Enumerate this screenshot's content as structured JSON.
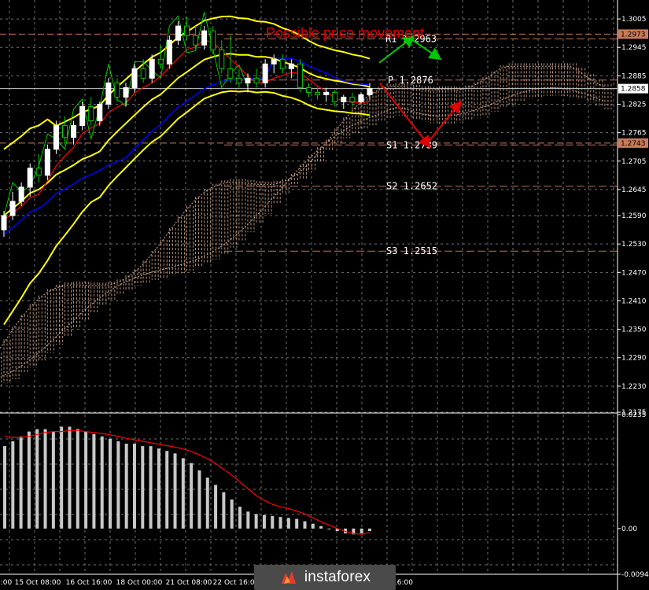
{
  "chart_data": {
    "type": "candlestick",
    "title": "Possible price movement",
    "price_axis": {
      "ticks": [
        "1.3005",
        "1.2945",
        "1.2885",
        "1.2825",
        "1.2765",
        "1.2705",
        "1.2645",
        "1.2590",
        "1.2530",
        "1.2470",
        "1.2410",
        "1.2350",
        "1.2290",
        "1.2230",
        "1.2175"
      ],
      "current_price": "1.2858",
      "marked_prices": [
        "1.2973",
        "1.2743"
      ],
      "range": [
        1.2175,
        1.3045
      ]
    },
    "indicator_axis": {
      "ticks": [
        "0.0235",
        "0.00",
        "-0.00942"
      ],
      "range": [
        -0.00942,
        0.0235
      ]
    },
    "time_axis": {
      "ticks": [
        ":00",
        "15 Oct 08:00",
        "16 Oct 16:00",
        "18 Oct 00:00",
        "21 Oct 08:00",
        "22 Oct 16:00",
        "16:00"
      ]
    },
    "levels": [
      {
        "name": "R1",
        "label": "R1 1.2963",
        "value": 1.2963
      },
      {
        "name": "P",
        "label": "P 1.2876",
        "value": 1.2876
      },
      {
        "name": "S1",
        "label": "S1 1.2739",
        "value": 1.2739
      },
      {
        "name": "S2",
        "label": "S2 1.2652",
        "value": 1.2652
      },
      {
        "name": "S3",
        "label": "S3 1.2515",
        "value": 1.2515
      }
    ],
    "candles": [
      [
        1.256,
        1.26,
        1.2545,
        1.259
      ],
      [
        1.259,
        1.264,
        1.258,
        1.262
      ],
      [
        1.262,
        1.266,
        1.261,
        1.265
      ],
      [
        1.265,
        1.27,
        1.263,
        1.269
      ],
      [
        1.269,
        1.272,
        1.266,
        1.2675
      ],
      [
        1.2675,
        1.274,
        1.2665,
        1.273
      ],
      [
        1.273,
        1.279,
        1.272,
        1.278
      ],
      [
        1.278,
        1.28,
        1.274,
        1.2755
      ],
      [
        1.2755,
        1.279,
        1.274,
        1.278
      ],
      [
        1.278,
        1.283,
        1.277,
        1.282
      ],
      [
        1.282,
        1.284,
        1.278,
        1.279
      ],
      [
        1.279,
        1.283,
        1.278,
        1.2825
      ],
      [
        1.2825,
        1.288,
        1.2815,
        1.287
      ],
      [
        1.287,
        1.288,
        1.283,
        1.284
      ],
      [
        1.284,
        1.287,
        1.282,
        1.286
      ],
      [
        1.286,
        1.291,
        1.285,
        1.29
      ],
      [
        1.29,
        1.292,
        1.287,
        1.288
      ],
      [
        1.288,
        1.293,
        1.287,
        1.292
      ],
      [
        1.292,
        1.295,
        1.29,
        1.291
      ],
      [
        1.291,
        1.297,
        1.29,
        1.296
      ],
      [
        1.296,
        1.3,
        1.295,
        1.299
      ],
      [
        1.299,
        1.301,
        1.296,
        1.297
      ],
      [
        1.297,
        1.299,
        1.294,
        1.295
      ],
      [
        1.295,
        1.299,
        1.294,
        1.298
      ],
      [
        1.298,
        1.299,
        1.293,
        1.294
      ],
      [
        1.294,
        1.296,
        1.289,
        1.29
      ],
      [
        1.29,
        1.297,
        1.287,
        1.288
      ],
      [
        1.288,
        1.29,
        1.286,
        1.287
      ],
      [
        1.287,
        1.289,
        1.285,
        1.288
      ],
      [
        1.288,
        1.29,
        1.286,
        1.287
      ],
      [
        1.287,
        1.292,
        1.286,
        1.291
      ],
      [
        1.291,
        1.293,
        1.289,
        1.292
      ],
      [
        1.292,
        1.293,
        1.289,
        1.29
      ],
      [
        1.29,
        1.292,
        1.288,
        1.291
      ],
      [
        1.291,
        1.292,
        1.285,
        1.286
      ],
      [
        1.286,
        1.287,
        1.284,
        1.285
      ],
      [
        1.285,
        1.286,
        1.2835,
        1.2845
      ],
      [
        1.2845,
        1.286,
        1.283,
        1.285
      ],
      [
        1.285,
        1.2855,
        1.282,
        1.283
      ],
      [
        1.283,
        1.2845,
        1.2815,
        1.284
      ],
      [
        1.284,
        1.285,
        1.282,
        1.283
      ],
      [
        1.283,
        1.285,
        1.2825,
        1.2845
      ],
      [
        1.2845,
        1.287,
        1.2835,
        1.2858
      ]
    ],
    "histogram": [
      0.017,
      0.018,
      0.019,
      0.02,
      0.0205,
      0.0205,
      0.02,
      0.021,
      0.021,
      0.0205,
      0.02,
      0.0195,
      0.019,
      0.0185,
      0.018,
      0.0175,
      0.0175,
      0.017,
      0.017,
      0.0165,
      0.016,
      0.0155,
      0.0145,
      0.0135,
      0.012,
      0.0105,
      0.009,
      0.0075,
      0.006,
      0.0045,
      0.0035,
      0.003,
      0.0028,
      0.0026,
      0.0024,
      0.0022,
      0.002,
      0.0015,
      0.001,
      0.0005,
      0.0,
      -0.0005,
      -0.001,
      -0.0012,
      -0.001,
      -0.0005
    ],
    "signal": [
      0.019,
      0.0188,
      0.0188,
      0.019,
      0.0194,
      0.0198,
      0.02,
      0.02,
      0.0202,
      0.0202,
      0.02,
      0.0198,
      0.0196,
      0.0193,
      0.019,
      0.0186,
      0.0183,
      0.018,
      0.0177,
      0.0174,
      0.0171,
      0.0168,
      0.0164,
      0.0159,
      0.0152,
      0.0144,
      0.0134,
      0.0122,
      0.011,
      0.0096,
      0.0082,
      0.0068,
      0.0058,
      0.005,
      0.0045,
      0.0041,
      0.0036,
      0.003,
      0.0022,
      0.0014,
      0.0007,
      0.0,
      -0.0006,
      -0.001,
      -0.0012,
      -0.0008
    ],
    "colors": {
      "bull_candle": "#ffffff",
      "bear_candle": "#00c800",
      "bollinger": "#ffff00",
      "kijun": "#0000ff",
      "tenkan": "#ff0000",
      "chikou": "#00c800",
      "cloud": "#d2a78a",
      "histogram": "#c8c8c8",
      "signal": "#ff0000",
      "title": "#e10000",
      "arrow_up": "#00c800",
      "arrow_down": "#e10000"
    },
    "forecast_arrows": [
      "green-up",
      "green-down",
      "red-down",
      "red-up"
    ]
  },
  "branding": {
    "logo_text": "instaforex"
  }
}
